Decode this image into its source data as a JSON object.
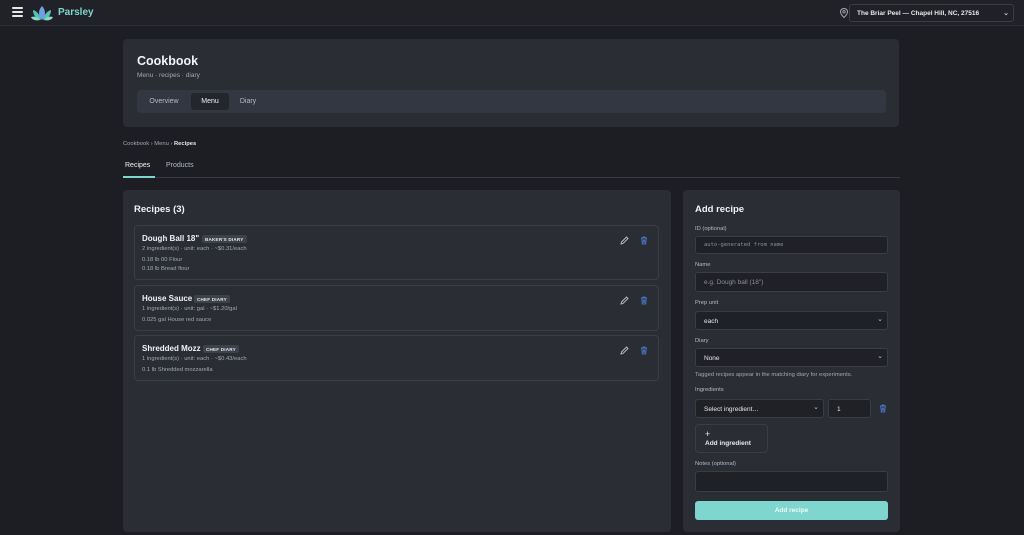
{
  "app": {
    "name": "Parsley",
    "location": "The Briar Peel — Chapel Hill, NC, 27516"
  },
  "header": {
    "title": "Cookbook",
    "subtitle": "Menu · recipes · diary",
    "tabs": [
      {
        "label": "Overview"
      },
      {
        "label": "Menu"
      },
      {
        "label": "Diary"
      }
    ],
    "active_tab": "Menu"
  },
  "breadcrumb": {
    "part1": "Cookbook",
    "sep": "›",
    "part2": "Menu",
    "current": "Recipes"
  },
  "subtabs": [
    {
      "label": "Recipes"
    },
    {
      "label": "Products"
    }
  ],
  "recipes": {
    "title": "Recipes (3)",
    "items": [
      {
        "name": "Dough Ball 18\"",
        "badge": "BAKER'S DIARY",
        "meta": "2 ingredient(s) · unit: each · ~$0.31/each",
        "lines": [
          "0.18 lb 00 Flour",
          "0.18 lb Bread flour"
        ]
      },
      {
        "name": "House Sauce",
        "badge": "CHEF DIARY",
        "meta": "1 ingredient(s) · unit: gal · ~$1.20/gal",
        "lines": [
          "0.025 gal House red sauce"
        ]
      },
      {
        "name": "Shredded Mozz",
        "badge": "CHEF DIARY",
        "meta": "1 ingredient(s) · unit: each · ~$0.43/each",
        "lines": [
          "0.1 lb Shredded mozzarella"
        ]
      }
    ]
  },
  "add_recipe": {
    "title": "Add recipe",
    "id_label": "ID (optional)",
    "id_placeholder": "auto-generated from name",
    "name_label": "Name",
    "name_placeholder": "e.g. Dough ball (18\")",
    "prep_unit_label": "Prep unit",
    "prep_unit_value": "each",
    "diary_label": "Diary",
    "diary_value": "None",
    "diary_hint": "Tagged recipes appear in the matching diary for experiments.",
    "ingredients_label": "Ingredients",
    "ingredient_select": "Select ingredient…",
    "ingredient_qty": "1",
    "add_ingredient_plus": "+",
    "add_ingredient": "Add ingredient",
    "notes_label": "Notes (optional)",
    "submit": "Add recipe"
  },
  "colors": {
    "accent": "#7fd6cf",
    "trash": "#4f86e8",
    "panel": "#2a2d34",
    "background": "#1c1e23"
  },
  "icons": {
    "menu": "hamburger-icon",
    "logo": "leaf-logo-icon",
    "location": "map-pin-icon",
    "edit": "pencil-icon",
    "delete": "trash-icon"
  }
}
